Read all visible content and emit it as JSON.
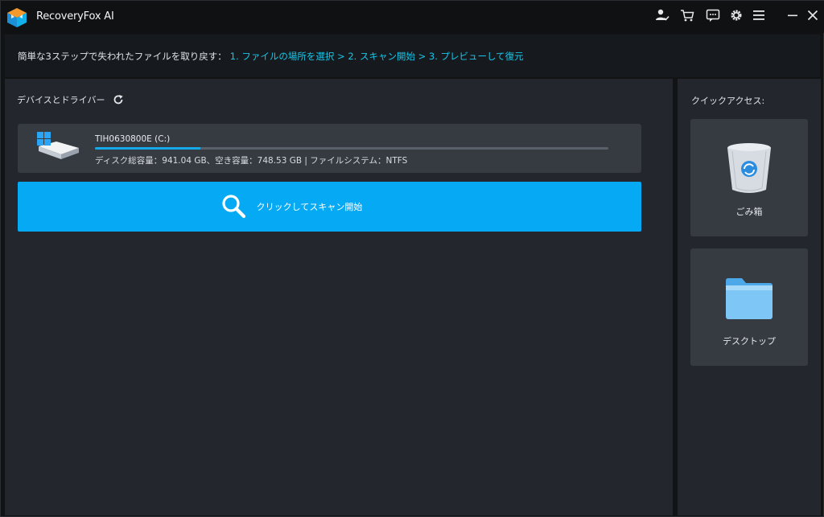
{
  "app": {
    "title": "RecoveryFox AI",
    "accent_color": "#05a9f4",
    "toolbar_icons": [
      "user-check-icon",
      "cart-icon",
      "feedback-icon",
      "gear-icon",
      "menu-icon",
      "minimize-icon",
      "close-icon"
    ]
  },
  "banner": {
    "lead": "簡単な3ステップで失われたファイルを取り戻す：",
    "steps": "1. ファイルの場所を選択 > 2. スキャン開始 > 3. プレビューして復元"
  },
  "devices": {
    "heading": "デバイスとドライバー",
    "drives": [
      {
        "name": "TIH0630800E (C:)",
        "used_fraction": 0.205,
        "info": "ディスク総容量：941.04 GB、空き容量：748.53 GB | ファイルシステム：NTFS"
      }
    ],
    "scan_label": "クリックしてスキャン開始"
  },
  "quick_access": {
    "title": "クイックアクセス:",
    "items": [
      {
        "label": "ごみ箱",
        "icon": "recycle-bin-icon"
      },
      {
        "label": "デスクトップ",
        "icon": "folder-icon"
      }
    ]
  }
}
